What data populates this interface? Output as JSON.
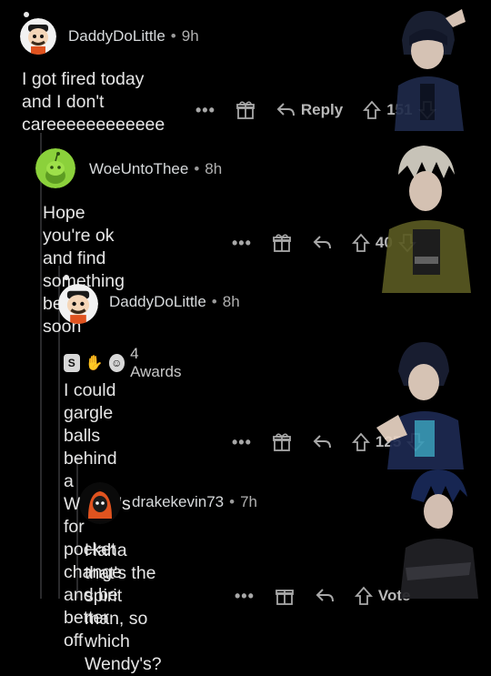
{
  "comments": [
    {
      "username": "DaddyDoLittle",
      "time": "9h",
      "body": "I got fired today and I don't careeeeeeeeeeee",
      "reply_label": "Reply",
      "votes": "151"
    },
    {
      "username": "WoeUntoThee",
      "time": "8h",
      "body": "Hope you're ok and find something better soon",
      "votes": "40"
    },
    {
      "username": "DaddyDoLittle",
      "time": "8h",
      "awards_label": "4 Awards",
      "body_line1": "I could gargle balls behind a Wendy's for",
      "body_line2": "pocket change and be better off",
      "votes": "125"
    },
    {
      "username": "drakekevin73",
      "time": "7h",
      "body_line1": "Haha that's the spirit man, so which",
      "body_line2": "Wendy's?",
      "votes": "Vote"
    }
  ],
  "separator": "•",
  "ellipsis": "•••",
  "colors": {
    "background": "#000000",
    "text": "#d7dadc",
    "muted": "#a8a8a8",
    "thread_line": "#2a2a2c",
    "avatar_green": "#8bd13b",
    "avatar_orange": "#e0531f"
  }
}
